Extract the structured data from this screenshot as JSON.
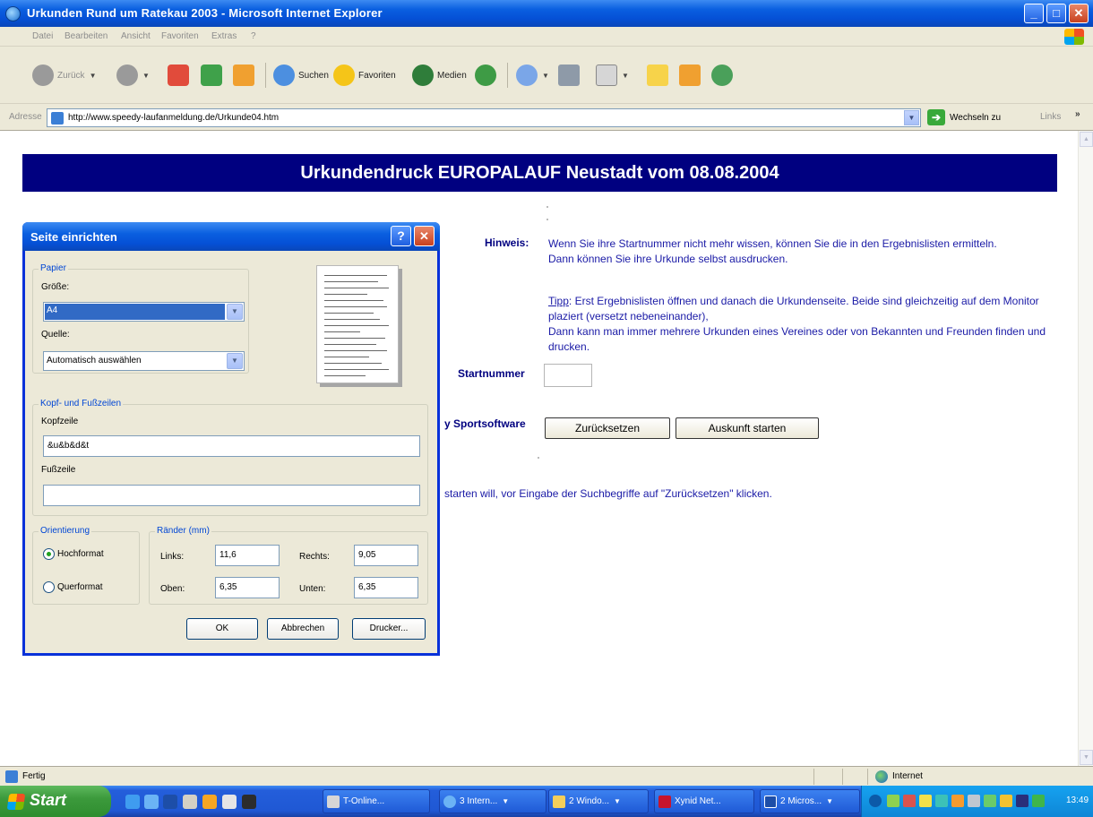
{
  "window": {
    "title": "Urkunden Rund um Ratekau 2003 - Microsoft Internet Explorer",
    "min": "_",
    "max": "□",
    "close": "✕"
  },
  "menu": [
    "Datei",
    "Bearbeiten",
    "Ansicht",
    "Favoriten",
    "Extras",
    "?"
  ],
  "toolbar": {
    "back": "Zurück",
    "search": "Suchen",
    "favorites": "Favoriten",
    "media": "Medien"
  },
  "address": {
    "label": "Adresse",
    "url": "http://www.speedy-laufanmeldung.de/Urkunde04.htm",
    "go": "Wechseln zu",
    "links": "Links",
    "chevron": "»"
  },
  "page": {
    "banner": "Urkundendruck EUROPALAUF Neustadt vom 08.08.2004",
    "hinweis_label": "Hinweis:",
    "hinweis_text": "Wenn Sie ihre Startnummer nicht mehr wissen, können Sie die in den Ergebnislisten ermitteln. Dann können Sie ihre Urkunde selbst ausdrucken.",
    "tipp_word": "Tipp",
    "tipp_text": ": Erst Ergebnislisten öffnen und danach die Urkundenseite. Beide sind gleichzeitig auf dem Monitor plaziert (versetzt nebeneinander),",
    "tipp_text2": "Dann kann man immer mehrere Urkunden eines Vereines oder von Bekannten und Freunden finden und drucken.",
    "startnummer_label": "Startnummer",
    "startnummer_value": "",
    "sportsoftware_label": "y Sportsoftware",
    "reset_button": "Zurücksetzen",
    "submit_button": "Auskunft starten",
    "hint2": "starten will, vor Eingabe der Suchbegriffe auf \"Zurücksetzen\" klicken."
  },
  "dialog": {
    "title": "Seite einrichten",
    "help": "?",
    "close": "✕",
    "paper_legend": "Papier",
    "size_label": "Größe:",
    "size_value": "A4",
    "source_label": "Quelle:",
    "source_value": "Automatisch auswählen",
    "header_footer_legend": "Kopf- und Fußzeilen",
    "header_label": "Kopfzeile",
    "header_value": "&u&b&d&t",
    "footer_label": "Fußzeile",
    "footer_value": "",
    "orientation_legend": "Orientierung",
    "portrait": "Hochformat",
    "landscape": "Querformat",
    "portrait_selected": true,
    "margins_legend": "Ränder (mm)",
    "left_label": "Links:",
    "left_value": "11,6",
    "right_label": "Rechts:",
    "right_value": "9,05",
    "top_label": "Oben:",
    "top_value": "6,35",
    "bottom_label": "Unten:",
    "bottom_value": "6,35",
    "ok": "OK",
    "cancel": "Abbrechen",
    "printer": "Drucker..."
  },
  "status": {
    "text": "Fertig",
    "zone": "Internet"
  },
  "taskbar": {
    "start": "Start",
    "tasks": [
      "T-Online...",
      "3 Intern...",
      "2 Windo...",
      "Xynid Net...",
      "2 Micros..."
    ],
    "clock": "13:49"
  },
  "colors": {
    "banner_bg": "#000080",
    "page_text": "#1a1aa6",
    "xp_blue": "#0a5fe0",
    "dialog_bg": "#ece9d8"
  }
}
